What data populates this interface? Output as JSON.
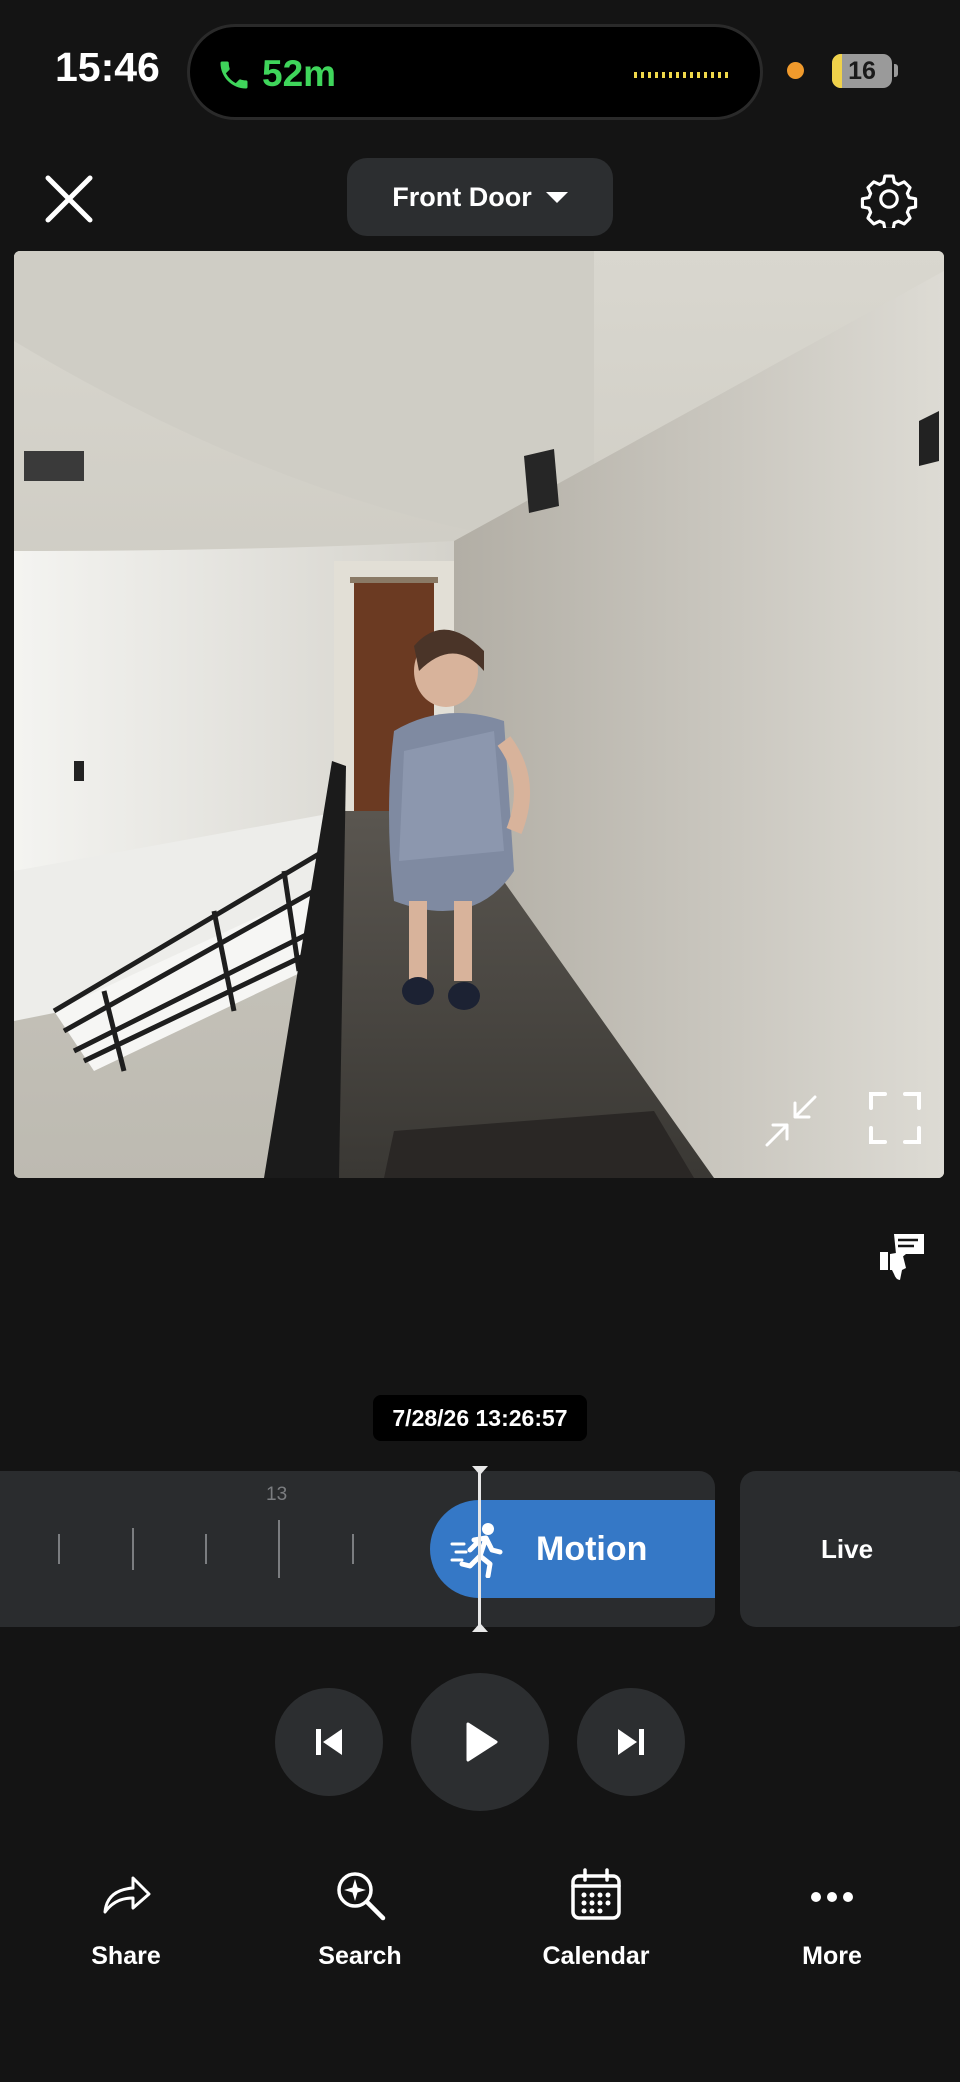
{
  "status_bar": {
    "time": "15:46",
    "call_duration": "52m",
    "battery_level": "16",
    "battery_fraction": 0.16
  },
  "header": {
    "camera_name": "Front Door",
    "close_icon": "close-icon",
    "settings_icon": "gear-icon"
  },
  "timeline": {
    "timestamp": "7/28/26 13:26:57",
    "hour_label": "13",
    "event_label": "Motion",
    "live_label": "Live"
  },
  "nav": {
    "share": "Share",
    "search": "Search",
    "calendar": "Calendar",
    "more": "More"
  },
  "colors": {
    "accent": "#3578c6",
    "call_green": "#3fd55b",
    "background": "#141414",
    "surface": "#2a2c2e"
  }
}
